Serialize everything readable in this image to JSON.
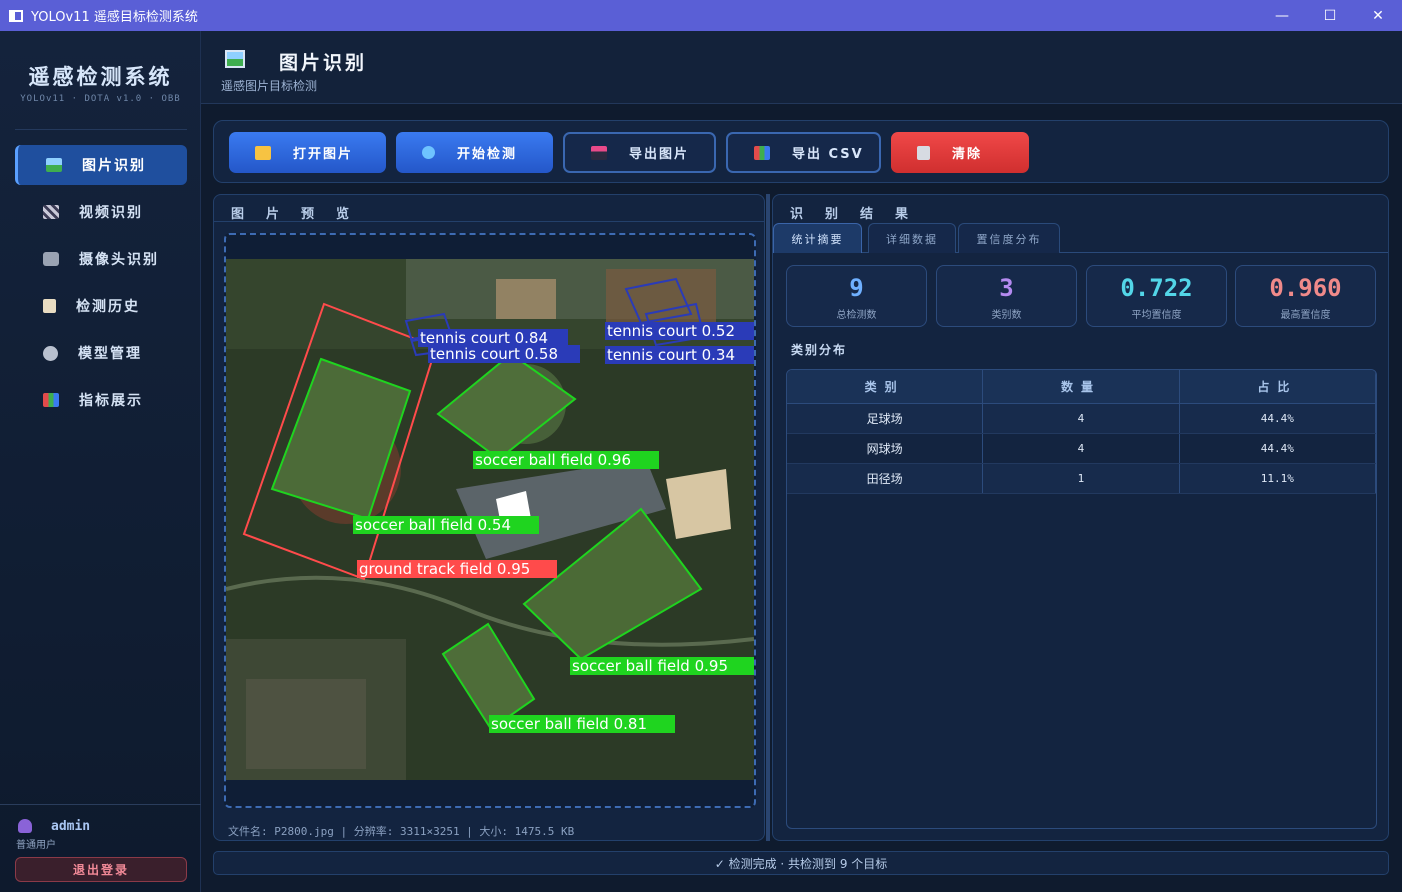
{
  "window": {
    "title": "YOLOv11 遥感目标检测系统",
    "minimize_icon": "minimize-icon",
    "maximize_icon": "maximize-icon",
    "close_icon": "close-icon"
  },
  "sidebar": {
    "brand_title": "遥感检测系统",
    "brand_subtitle": "YOLOv11 · DOTA v1.0 · OBB",
    "items": [
      {
        "label": "图片识别",
        "icon": "image-icon",
        "active": true
      },
      {
        "label": "视频识别",
        "icon": "clapper-icon",
        "active": false
      },
      {
        "label": "摄像头识别",
        "icon": "camera-icon",
        "active": false
      },
      {
        "label": "检测历史",
        "icon": "clipboard-icon",
        "active": false
      },
      {
        "label": "模型管理",
        "icon": "gear-icon",
        "active": false
      },
      {
        "label": "指标展示",
        "icon": "bar-chart-icon",
        "active": false
      }
    ],
    "user": {
      "name": "admin",
      "role": "普通用户",
      "icon": "user-icon"
    },
    "logout_label": "退出登录"
  },
  "header": {
    "title": "图片识别",
    "subtitle": "遥感图片目标检测",
    "icon": "image-icon"
  },
  "toolbar": {
    "open_label": "打开图片",
    "detect_label": "开始检测",
    "export_image_label": "导出图片",
    "export_csv_label": "导出 CSV",
    "clear_label": "清除",
    "colors": {
      "primary": "#2f6ae0",
      "danger": "#e33b3b"
    }
  },
  "preview": {
    "title": "图片预览",
    "file_info": "文件名: P2800.jpg  |  分辨率: 3311×3251  |  大小: 1475.5 KB",
    "detections": [
      {
        "label": "tennis court 0.84",
        "color": "#2a3bb8"
      },
      {
        "label": "tennis court 0.58",
        "color": "#2a3bb8"
      },
      {
        "label": "tennis court 0.52",
        "color": "#2a3bb8"
      },
      {
        "label": "tennis court 0.34",
        "color": "#2a3bb8"
      },
      {
        "label": "soccer ball field 0.96",
        "color": "#1fd41f"
      },
      {
        "label": "soccer ball field 0.54",
        "color": "#1fd41f"
      },
      {
        "label": "ground track field 0.95",
        "color": "#ff4b4b"
      },
      {
        "label": "soccer ball field 0.95",
        "color": "#1fd41f"
      },
      {
        "label": "soccer ball field 0.81",
        "color": "#1fd41f"
      }
    ]
  },
  "results": {
    "title": "识别结果",
    "tabs": [
      "统计摘要",
      "详细数据",
      "置信度分布"
    ],
    "stats": [
      {
        "value": "9",
        "label": "总检测数",
        "color": "#6fb0ff"
      },
      {
        "value": "3",
        "label": "类别数",
        "color": "#b48af0"
      },
      {
        "value": "0.722",
        "label": "平均置信度",
        "color": "#53d6e8"
      },
      {
        "value": "0.960",
        "label": "最高置信度",
        "color": "#f08a8a"
      }
    ],
    "section_title": "类别分布",
    "table": {
      "headers": [
        "类别",
        "数量",
        "占比"
      ],
      "rows": [
        [
          "足球场",
          "4",
          "44.4%"
        ],
        [
          "网球场",
          "4",
          "44.4%"
        ],
        [
          "田径场",
          "1",
          "11.1%"
        ]
      ]
    }
  },
  "status": {
    "text": "✓ 检测完成 · 共检测到 9 个目标"
  }
}
